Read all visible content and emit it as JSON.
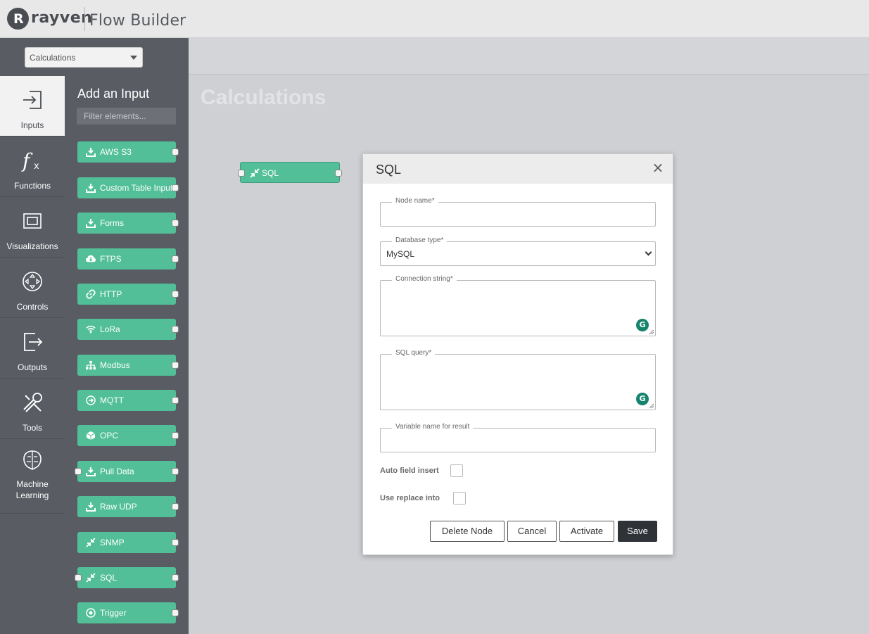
{
  "header": {
    "brand": "rayven",
    "brand_letter": "R",
    "app_title": "Flow Builder"
  },
  "rail": [
    {
      "label": "Inputs",
      "icon": "input-icon",
      "active": true
    },
    {
      "label": "Functions",
      "icon": "function-icon"
    },
    {
      "label": "Visualizations",
      "icon": "visualization-icon"
    },
    {
      "label": "Controls",
      "icon": "controls-icon"
    },
    {
      "label": "Outputs",
      "icon": "output-icon"
    },
    {
      "label": "Tools",
      "icon": "tools-icon"
    },
    {
      "label": "Machine Learning",
      "icon": "brain-icon"
    }
  ],
  "panel": {
    "dropdown_value": "Calculations",
    "title": "Add an Input",
    "filter_placeholder": "Filter elements...",
    "items": [
      {
        "label": "AWS S3",
        "icon": "download-icon"
      },
      {
        "label": "Custom Table Input",
        "icon": "download-icon"
      },
      {
        "label": "Forms",
        "icon": "download-icon"
      },
      {
        "label": "FTPS",
        "icon": "cloud-download-icon"
      },
      {
        "label": "HTTP",
        "icon": "link-icon"
      },
      {
        "label": "LoRa",
        "icon": "wifi-icon"
      },
      {
        "label": "Modbus",
        "icon": "sitemap-icon"
      },
      {
        "label": "MQTT",
        "icon": "arrow-circle-icon"
      },
      {
        "label": "OPC",
        "icon": "cube-icon"
      },
      {
        "label": "Pull Data",
        "icon": "download-icon"
      },
      {
        "label": "Raw UDP",
        "icon": "download-icon"
      },
      {
        "label": "SNMP",
        "icon": "compress-icon"
      },
      {
        "label": "SQL",
        "icon": "compress-icon"
      },
      {
        "label": "Trigger",
        "icon": "target-icon"
      }
    ]
  },
  "canvas": {
    "title": "Calculations",
    "node_label": "SQL"
  },
  "dialog": {
    "title": "SQL",
    "close": "×",
    "node_name": {
      "label": "Node name*",
      "value": ""
    },
    "db_type": {
      "label": "Database type*",
      "value": "MySQL"
    },
    "conn": {
      "label": "Connection string*",
      "value": ""
    },
    "query": {
      "label": "SQL query*",
      "value": ""
    },
    "var": {
      "label": "Variable name for result",
      "value": ""
    },
    "grammarly": "G",
    "auto_insert": {
      "label": "Auto field insert",
      "checked": false
    },
    "replace_into": {
      "label": "Use replace into",
      "checked": false
    },
    "buttons": {
      "delete": "Delete Node",
      "cancel": "Cancel",
      "activate": "Activate",
      "save": "Save"
    }
  },
  "colors": {
    "node_green": "#52bf99",
    "rail_bg": "#595c63",
    "canvas_bg": "#cfd0d4",
    "grammarly": "#15836d"
  }
}
